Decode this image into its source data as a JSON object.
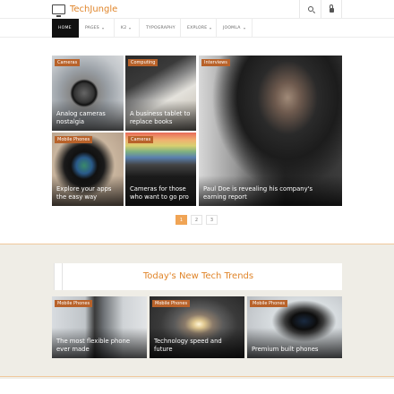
{
  "header": {
    "site_name": "TechJungle",
    "icons": [
      "monitor-icon",
      "search-icon",
      "lock-icon"
    ]
  },
  "nav": {
    "items": [
      {
        "label": "Home",
        "active": true,
        "dropdown": false
      },
      {
        "label": "Pages",
        "active": false,
        "dropdown": true
      },
      {
        "label": "K2",
        "active": false,
        "dropdown": true
      },
      {
        "label": "Typography",
        "active": false,
        "dropdown": false
      },
      {
        "label": "Explore",
        "active": false,
        "dropdown": true
      },
      {
        "label": "Joomla",
        "active": false,
        "dropdown": true
      }
    ]
  },
  "featured": [
    {
      "category": "Cameras",
      "title": "Analog cameras nostalgia"
    },
    {
      "category": "Computing",
      "title": "A business tablet to replace books"
    },
    {
      "category": "Interviews",
      "title": "Paul Doe is revealing his company's earning report"
    },
    {
      "category": "Mobile Phones",
      "title": "Explore your apps the easy way"
    },
    {
      "category": "Cameras",
      "title": "Cameras for those who want to go pro"
    }
  ],
  "pagination": {
    "pages": [
      "1",
      "2",
      "3"
    ],
    "current": "1"
  },
  "trends": {
    "title": "Today's New Tech Trends",
    "items": [
      {
        "category": "Mobile Phones",
        "title": "The most flexible phone ever made"
      },
      {
        "category": "Mobile Phones",
        "title": "Technology speed and future"
      },
      {
        "category": "Mobile Phones",
        "title": "Premium built phones"
      }
    ]
  },
  "colors": {
    "accent": "#e0852a",
    "badge": "#b8622a",
    "pager_active": "#f0a455",
    "section_bg": "#efede6"
  }
}
